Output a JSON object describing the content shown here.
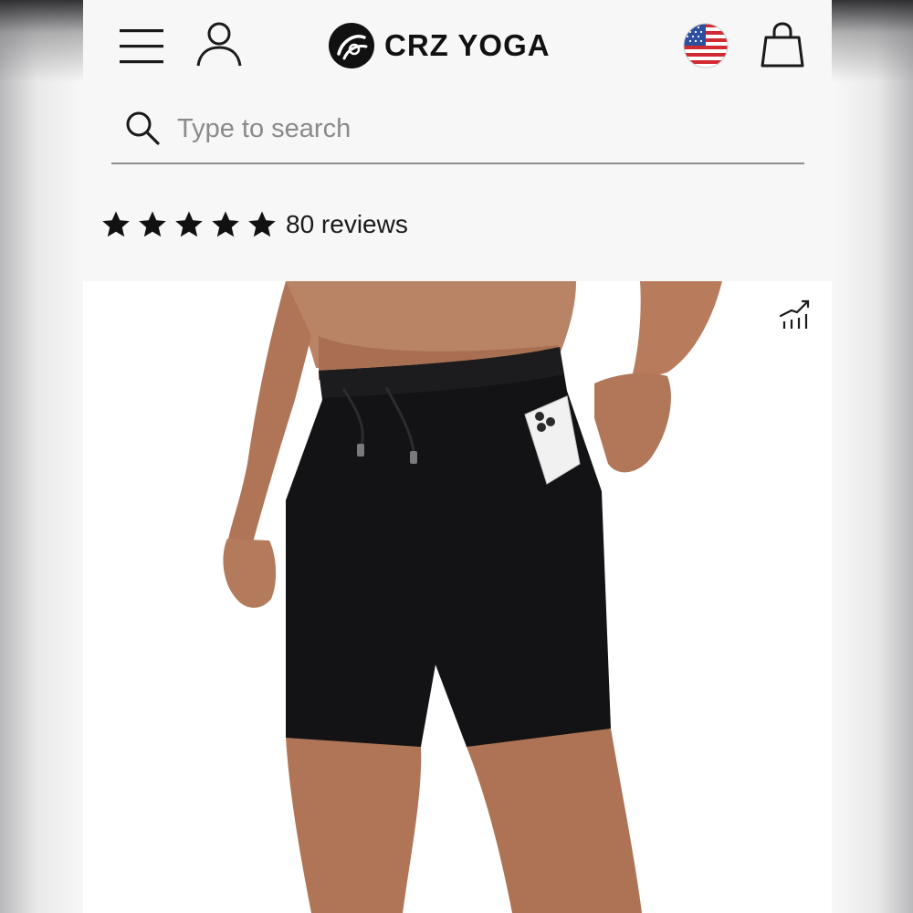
{
  "brand": {
    "name": "CRZ YOGA"
  },
  "search": {
    "placeholder": "Type to search",
    "value": ""
  },
  "rating": {
    "stars": 5,
    "reviews_label": "80 reviews"
  },
  "icons": {
    "menu": "hamburger-menu-icon",
    "account": "user-icon",
    "region": "us-flag-icon",
    "cart": "shopping-bag-icon",
    "search": "search-icon",
    "star": "star-icon",
    "trend": "trending-chart-icon"
  },
  "colors": {
    "text": "#111111",
    "star": "#111111",
    "underline": "#8e8e90",
    "placeholder": "#8a8a8c"
  },
  "product_image": {
    "subject": "black drawstring shorts"
  }
}
